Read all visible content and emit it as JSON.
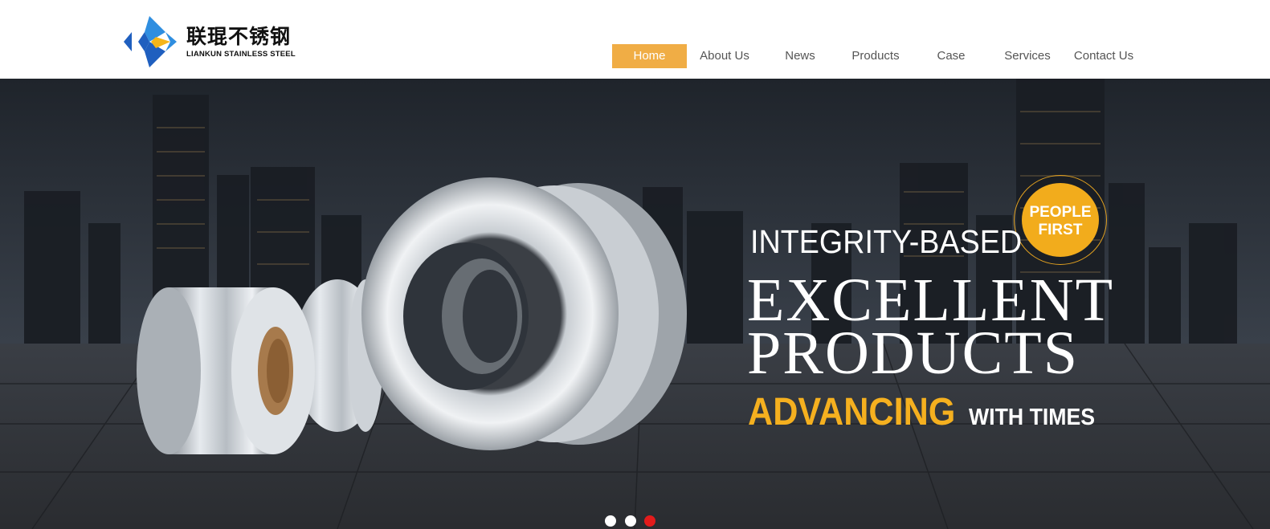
{
  "brand": {
    "name_cn": "联琨不锈钢",
    "name_en": "LIANKUN STAINLESS STEEL",
    "colors": {
      "blue": "#1f5fbf",
      "light_blue": "#2f8ee0",
      "yellow": "#f5b51a"
    }
  },
  "nav": {
    "items": [
      {
        "label": "Home",
        "active": true
      },
      {
        "label": "About Us",
        "active": false
      },
      {
        "label": "News",
        "active": false
      },
      {
        "label": "Products",
        "active": false
      },
      {
        "label": "Case",
        "active": false
      },
      {
        "label": "Services",
        "active": false
      },
      {
        "label": "Contact Us",
        "active": false
      }
    ],
    "active_color": "#f0ad45"
  },
  "banner": {
    "line1": "INTEGRITY-BASED",
    "line2": "EXCELLENT",
    "line3": "PRODUCTS",
    "line4_highlight": "ADVANCING",
    "line4_rest": "WITH TIMES",
    "badge": {
      "line1": "PEOPLE",
      "line2": "FIRST",
      "color": "#f2ac1c"
    },
    "accent_color": "#f5b01f",
    "carousel": {
      "total": 3,
      "active_index": 3,
      "active_color": "#e31b1b"
    }
  }
}
